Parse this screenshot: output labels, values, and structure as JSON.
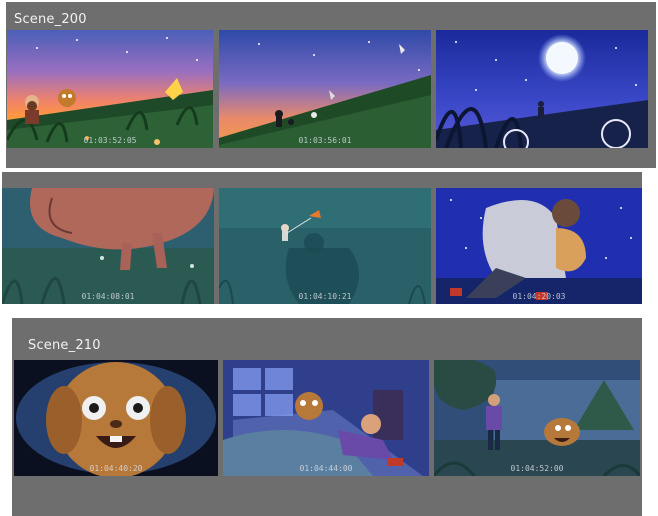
{
  "colors": {
    "panel_bg": "#6e6e6e",
    "page_bg": "#ffffff",
    "label_text": "#f2f2f2",
    "timecode_text": "#d8dde6"
  },
  "scenes": [
    {
      "label": "Scene_200",
      "frames": [
        {
          "timecode": "01:03:52:05",
          "art": "sunset-boy-and-dog-on-hill"
        },
        {
          "timecode": "01:03:56:01",
          "art": "silhouette-on-hill-twilight"
        },
        {
          "timecode": "",
          "art": "night-hill-under-full-moon"
        }
      ]
    },
    {
      "label": "",
      "frames": [
        {
          "timecode": "01:04:08:01",
          "art": "dog-running-through-grass"
        },
        {
          "timecode": "01:04:10:21",
          "art": "shadow-on-teal-field"
        },
        {
          "timecode": "01:04:20:03",
          "art": "boy-hugging-dog-starry-night"
        }
      ]
    },
    {
      "label": "Scene_210",
      "frames": [
        {
          "timecode": "01:04:40:20",
          "art": "dog-face-closeup-vignette"
        },
        {
          "timecode": "01:04:44:00",
          "art": "dog-and-boy-in-bed-at-night"
        },
        {
          "timecode": "01:04:52:00",
          "art": "boy-and-dog-in-night-garden"
        }
      ]
    }
  ]
}
